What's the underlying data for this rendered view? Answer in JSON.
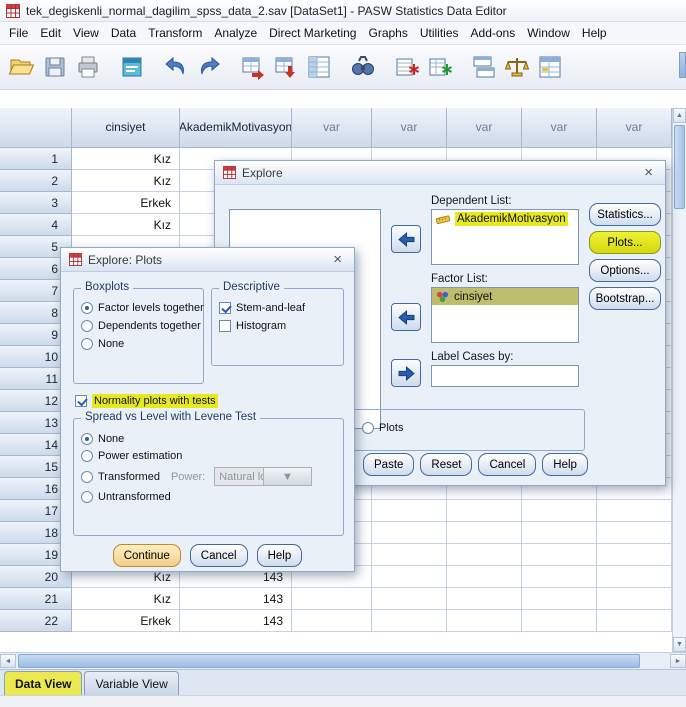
{
  "window": {
    "title": "tek_degiskenli_normal_dagilim_spss_data_2.sav [DataSet1] - PASW Statistics Data Editor"
  },
  "menubar": {
    "items": [
      "File",
      "Edit",
      "View",
      "Data",
      "Transform",
      "Analyze",
      "Direct Marketing",
      "Graphs",
      "Utilities",
      "Add-ons",
      "Window",
      "Help"
    ]
  },
  "toolbar": {
    "icons": [
      "open-data",
      "save",
      "print",
      "recall-dialogs",
      "undo",
      "redo",
      "goto-case",
      "goto-variable",
      "variables",
      "find",
      "insert-cases",
      "insert-variable",
      "split-file",
      "weight-cases",
      "value-labels"
    ]
  },
  "grid": {
    "columns": [
      "cinsiyet",
      "AkademikMotivasyon",
      "var",
      "var",
      "var",
      "var",
      "var"
    ],
    "rows": [
      {
        "num": "1",
        "cinsiyet": "Kız",
        "akademik": ""
      },
      {
        "num": "2",
        "cinsiyet": "Kız",
        "akademik": ""
      },
      {
        "num": "3",
        "cinsiyet": "Erkek",
        "akademik": ""
      },
      {
        "num": "4",
        "cinsiyet": "Kız",
        "akademik": ""
      },
      {
        "num": "5",
        "cinsiyet": "",
        "akademik": ""
      },
      {
        "num": "6",
        "cinsiyet": "",
        "akademik": ""
      },
      {
        "num": "7",
        "cinsiyet": "",
        "akademik": ""
      },
      {
        "num": "8",
        "cinsiyet": "",
        "akademik": ""
      },
      {
        "num": "9",
        "cinsiyet": "",
        "akademik": ""
      },
      {
        "num": "10",
        "cinsiyet": "",
        "akademik": ""
      },
      {
        "num": "11",
        "cinsiyet": "",
        "akademik": ""
      },
      {
        "num": "12",
        "cinsiyet": "",
        "akademik": ""
      },
      {
        "num": "13",
        "cinsiyet": "",
        "akademik": ""
      },
      {
        "num": "14",
        "cinsiyet": "",
        "akademik": ""
      },
      {
        "num": "15",
        "cinsiyet": "",
        "akademik": ""
      },
      {
        "num": "16",
        "cinsiyet": "",
        "akademik": ""
      },
      {
        "num": "17",
        "cinsiyet": "",
        "akademik": ""
      },
      {
        "num": "18",
        "cinsiyet": "",
        "akademik": ""
      },
      {
        "num": "19",
        "cinsiyet": "",
        "akademik": ""
      },
      {
        "num": "20",
        "cinsiyet": "Kız",
        "akademik": "143"
      },
      {
        "num": "21",
        "cinsiyet": "Kız",
        "akademik": "143"
      },
      {
        "num": "22",
        "cinsiyet": "Erkek",
        "akademik": "143"
      }
    ]
  },
  "tabs": {
    "data_view": "Data View",
    "variable_view": "Variable View"
  },
  "explore_dialog": {
    "title": "Explore",
    "dependent_label": "Dependent List:",
    "dependent_items": [
      "AkademikMotivasyon"
    ],
    "factor_label": "Factor List:",
    "factor_items": [
      "cinsiyet"
    ],
    "label_cases_label": "Label Cases by:",
    "side_buttons": [
      {
        "label": "Statistics...",
        "highlighted": false
      },
      {
        "label": "Plots...",
        "highlighted": true
      },
      {
        "label": "Options...",
        "highlighted": false
      },
      {
        "label": "Bootstrap...",
        "highlighted": false
      }
    ],
    "display_plots_label": "Plots",
    "bottom_buttons": [
      "Paste",
      "Reset",
      "Cancel",
      "Help"
    ]
  },
  "plots_dialog": {
    "title": "Explore: Plots",
    "boxplots": {
      "legend": "Boxplots",
      "options": [
        {
          "label": "Factor levels together",
          "selected": true
        },
        {
          "label": "Dependents together",
          "selected": false
        },
        {
          "label": "None",
          "selected": false
        }
      ]
    },
    "descriptive": {
      "legend": "Descriptive",
      "options": [
        {
          "label": "Stem-and-leaf",
          "checked": true
        },
        {
          "label": "Histogram",
          "checked": false
        }
      ]
    },
    "normality": {
      "label": "Normality plots with tests",
      "checked": true
    },
    "spread": {
      "legend": "Spread vs Level with Levene Test",
      "options": [
        {
          "label": "None",
          "selected": true
        },
        {
          "label": "Power estimation",
          "selected": false
        },
        {
          "label": "Transformed",
          "selected": false
        },
        {
          "label": "Untransformed",
          "selected": false
        }
      ],
      "power_label": "Power:",
      "power_value": "Natural log"
    },
    "buttons": [
      {
        "label": "Continue",
        "focused": true
      },
      {
        "label": "Cancel",
        "focused": false
      },
      {
        "label": "Help",
        "focused": false
      }
    ]
  },
  "colors": {
    "highlight": "#e6e91f",
    "selected_olive": "#bcbd6d",
    "accent_blue": "#2a5db0",
    "dialog_bg": "#e9f0f8",
    "tab_active": "#eae94f"
  }
}
